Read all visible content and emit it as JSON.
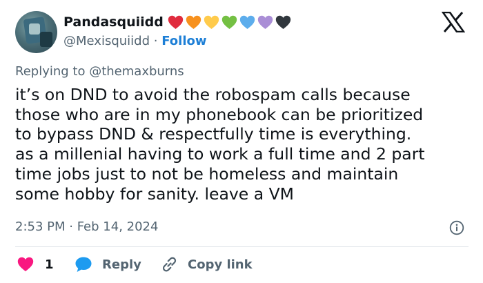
{
  "user": {
    "display_name": "Pandasquiidd",
    "handle": "@Mexisquiidd",
    "separator": "·",
    "follow_label": "Follow",
    "heart_emojis": [
      "#e02c3e",
      "#f7911e",
      "#ffcb4c",
      "#74c043",
      "#5dadec",
      "#aa8ed6",
      "#31373d"
    ]
  },
  "replying": {
    "prefix": "Replying to",
    "mention": "@themaxburns"
  },
  "tweet": {
    "lines": [
      "it’s on DND to avoid the robospam calls because",
      "those who are in my phonebook can be prioritized",
      "to bypass DND & respectfully time is everything.",
      "as a millenial having to work a full time and 2 part",
      "time jobs just to not be homeless and maintain",
      "some hobby for sanity. leave a VM"
    ],
    "timestamp": "2:53 PM · Feb 14, 2024"
  },
  "actions": {
    "like_count": "1",
    "reply_label": "Reply",
    "copy_label": "Copy link"
  },
  "colors": {
    "like": "#f91880",
    "reply": "#1d9bf0",
    "follow": "#1d7fd6",
    "secondary_text": "#536471"
  },
  "icons": {
    "logo": "x-logo-icon",
    "info": "info-icon",
    "like": "heart-icon",
    "reply": "speech-bubble-icon",
    "copy": "link-icon"
  }
}
